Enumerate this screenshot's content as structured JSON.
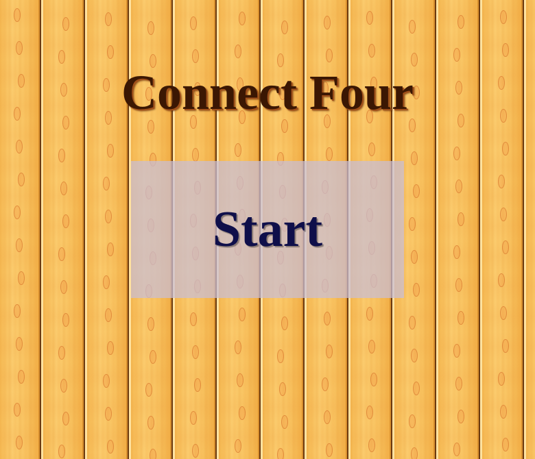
{
  "game": {
    "title": "Connect Four",
    "start_label": "Start"
  },
  "theme": {
    "background": "wood-planks",
    "title_color": "#3b1703",
    "start_text_color": "#0f0f4a"
  }
}
